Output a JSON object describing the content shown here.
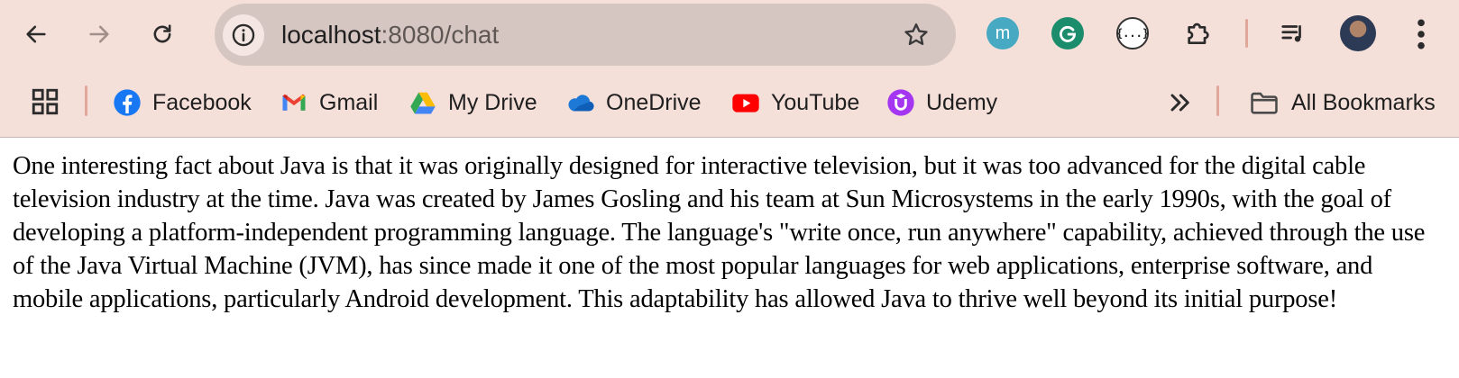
{
  "browser": {
    "url_host": "localhost",
    "url_path": ":8080/chat",
    "extensions": [
      {
        "name": "m-extension",
        "label": "m"
      },
      {
        "name": "grammarly-extension",
        "label": "G"
      },
      {
        "name": "json-extension",
        "label": "{...}"
      }
    ],
    "bookmarks": [
      {
        "label": "Facebook",
        "icon": "facebook-icon"
      },
      {
        "label": "Gmail",
        "icon": "gmail-icon"
      },
      {
        "label": "My Drive",
        "icon": "google-drive-icon"
      },
      {
        "label": "OneDrive",
        "icon": "onedrive-icon"
      },
      {
        "label": "YouTube",
        "icon": "youtube-icon"
      },
      {
        "label": "Udemy",
        "icon": "udemy-icon"
      }
    ],
    "all_bookmarks_label": "All Bookmarks",
    "colors": {
      "chrome_bg": "#f4dfd9",
      "omnibox_bg": "#d6c6c1",
      "divider": "#e0a89a"
    }
  },
  "page": {
    "text": "One interesting fact about Java is that it was originally designed for interactive television, but it was too advanced for the digital cable television industry at the time. Java was created by James Gosling and his team at Sun Microsystems in the early 1990s, with the goal of developing a platform-independent programming language. The language's \"write once, run anywhere\" capability, achieved through the use of the Java Virtual Machine (JVM), has since made it one of the most popular languages for web applications, enterprise software, and mobile applications, particularly Android development. This adaptability has allowed Java to thrive well beyond its initial purpose!"
  }
}
